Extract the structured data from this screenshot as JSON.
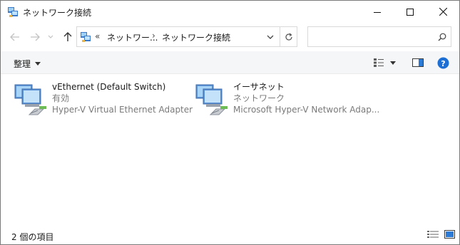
{
  "window": {
    "title": "ネットワーク接続"
  },
  "address": {
    "overflow": "«",
    "crumbs": [
      "ネットワー...",
      "ネットワーク接続"
    ],
    "separator": "›"
  },
  "search": {
    "placeholder": "",
    "value": ""
  },
  "toolbar": {
    "organize_label": "整理"
  },
  "items": [
    {
      "name": "vEthernet (Default Switch)",
      "status": "有効",
      "device": "Hyper-V Virtual Ethernet Adapter"
    },
    {
      "name": "イーサネット",
      "status": "ネットワーク",
      "device": "Microsoft Hyper-V Network Adap..."
    }
  ],
  "statusbar": {
    "count": "2 個の項目"
  },
  "colors": {
    "accent": "#0078d7",
    "help": "#1e6fd4",
    "muted": "#7a7a7a"
  },
  "icons": {
    "back": "arrow-left-icon",
    "forward": "arrow-right-icon",
    "recent": "chevron-down-icon",
    "up": "arrow-up-icon",
    "refresh": "refresh-icon",
    "search": "search-icon",
    "help": "help-icon",
    "adapter": "network-adapter-icon"
  }
}
